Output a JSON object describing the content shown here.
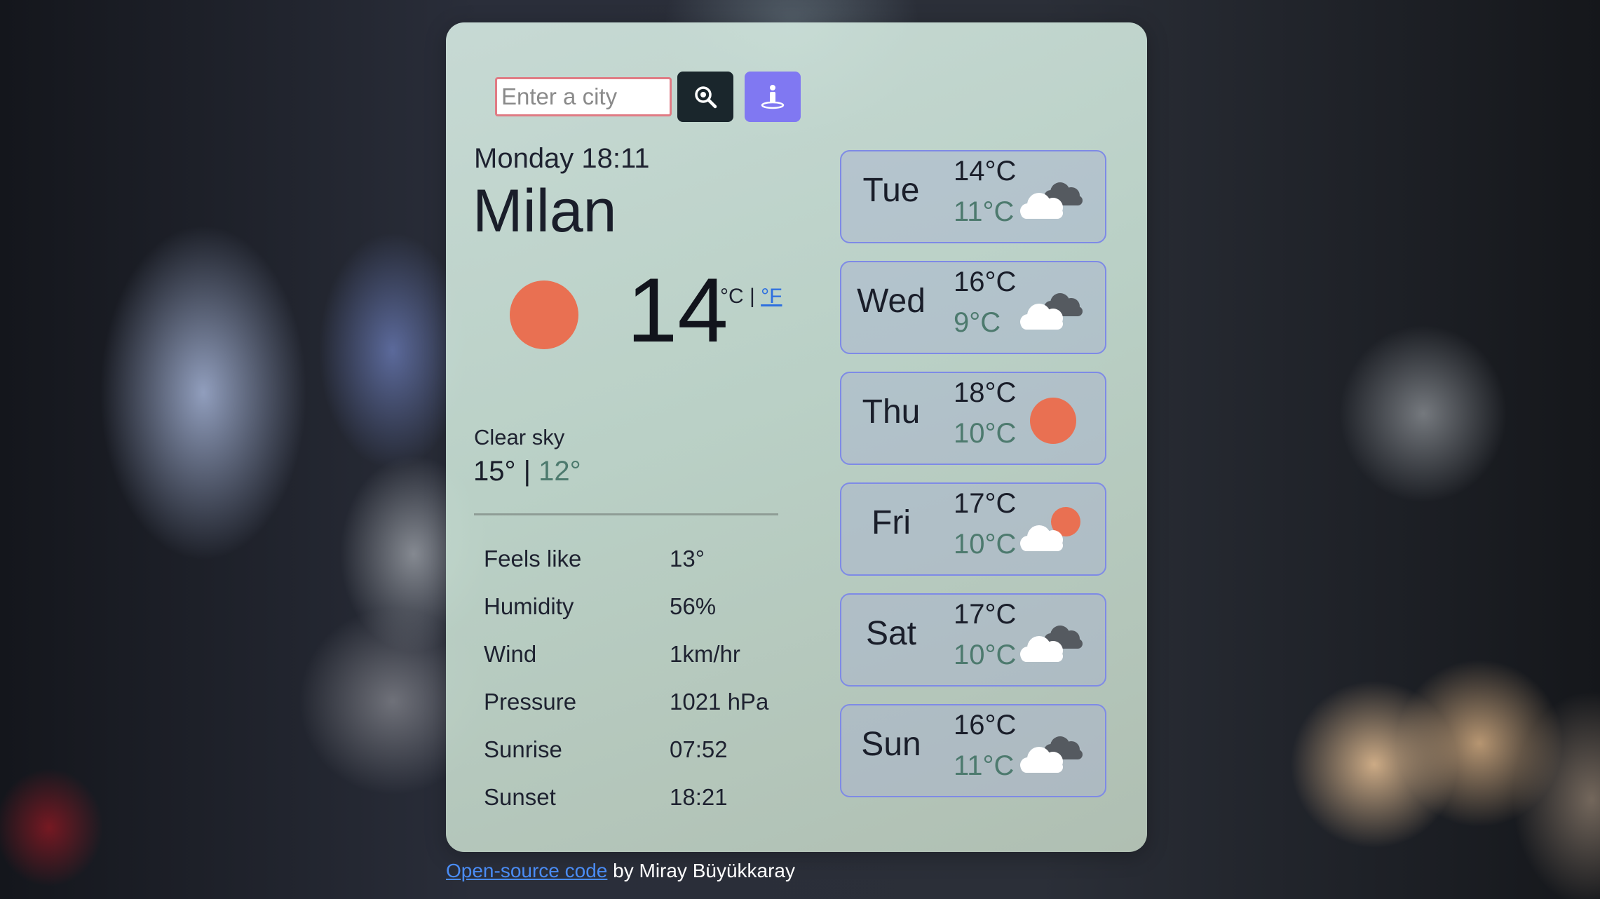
{
  "search": {
    "placeholder": "Enter a city",
    "value": ""
  },
  "current": {
    "date": "Monday 18:11",
    "city": "Milan",
    "temperature": "14",
    "unit_celsius": "°C",
    "unit_separator": "|",
    "unit_fahrenheit": "°F",
    "description": "Clear sky",
    "high": "15°",
    "low": "12°",
    "hilo_separator": "|",
    "icon": "sun-icon"
  },
  "details": [
    {
      "label": "Feels like",
      "value": "13°"
    },
    {
      "label": "Humidity",
      "value": "56%"
    },
    {
      "label": "Wind",
      "value": "1km/hr"
    },
    {
      "label": "Pressure",
      "value": "1021 hPa"
    },
    {
      "label": "Sunrise",
      "value": "07:52"
    },
    {
      "label": "Sunset",
      "value": "18:21"
    }
  ],
  "forecast": [
    {
      "day": "Tue",
      "max": "14°C",
      "min": "11°C",
      "icon": "broken-clouds-icon"
    },
    {
      "day": "Wed",
      "max": "16°C",
      "min": "9°C",
      "icon": "broken-clouds-icon"
    },
    {
      "day": "Thu",
      "max": "18°C",
      "min": "10°C",
      "icon": "sun-icon"
    },
    {
      "day": "Fri",
      "max": "17°C",
      "min": "10°C",
      "icon": "partly-cloudy-icon"
    },
    {
      "day": "Sat",
      "max": "17°C",
      "min": "10°C",
      "icon": "broken-clouds-icon"
    },
    {
      "day": "Sun",
      "max": "16°C",
      "min": "11°C",
      "icon": "broken-clouds-icon"
    }
  ],
  "footer": {
    "link_text": "Open-source code",
    "suffix": "by Miray Büyükkaray"
  },
  "colors": {
    "sun": "#e97052",
    "search_button": "#1a262c",
    "location_button": "#8078f2",
    "link": "#2d6fe0",
    "min_temp": "#4d7a6e"
  }
}
